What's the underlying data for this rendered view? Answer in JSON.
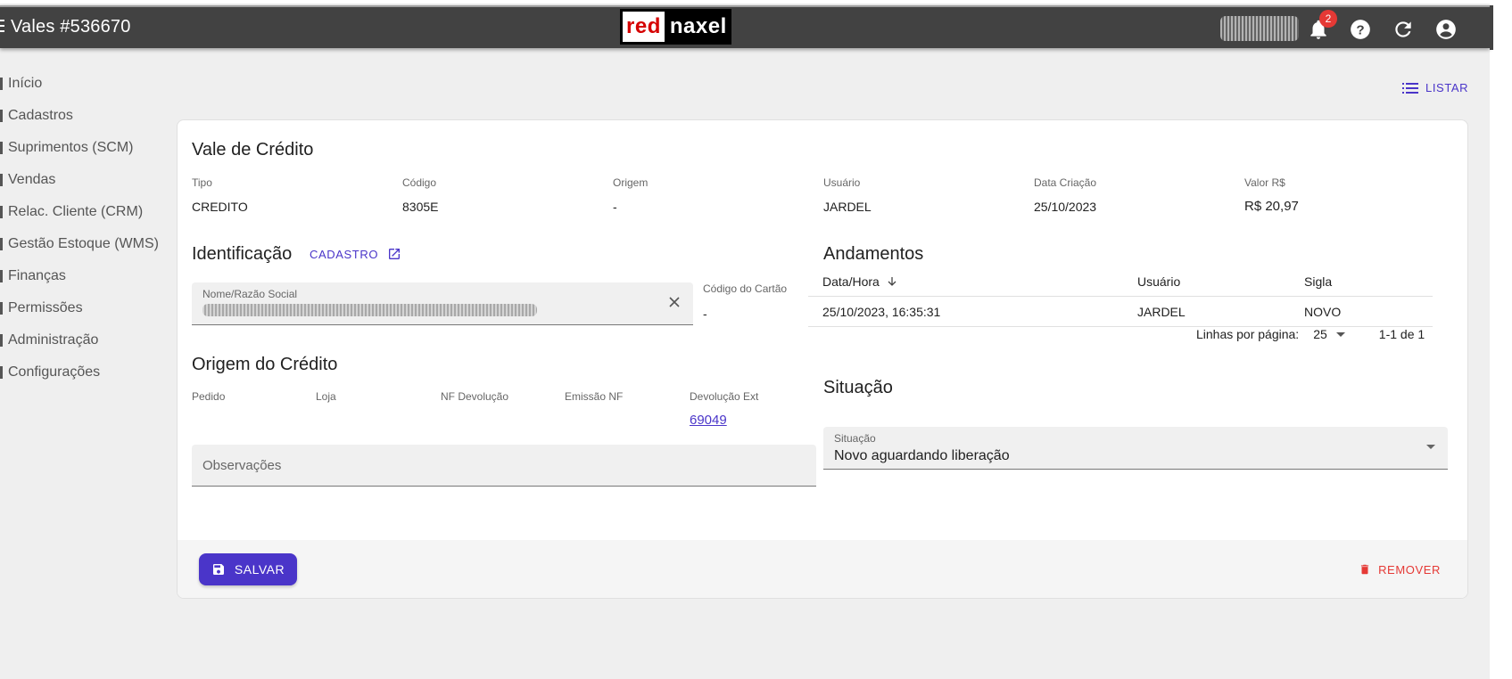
{
  "header": {
    "title": "Vales #536670",
    "logo_red": "red",
    "logo_naxel": "naxel",
    "notification_count": "2"
  },
  "sidebar": {
    "items": [
      {
        "label": "Início"
      },
      {
        "label": "Cadastros"
      },
      {
        "label": "Suprimentos (SCM)"
      },
      {
        "label": "Vendas"
      },
      {
        "label": "Relac. Cliente (CRM)"
      },
      {
        "label": "Gestão Estoque (WMS)"
      },
      {
        "label": "Finanças"
      },
      {
        "label": "Permissões"
      },
      {
        "label": "Administração"
      },
      {
        "label": "Configurações"
      }
    ]
  },
  "toolbar": {
    "listar_label": "LISTAR"
  },
  "vale": {
    "title": "Vale de Crédito",
    "fields": [
      {
        "label": "Tipo",
        "value": "CREDITO"
      },
      {
        "label": "Código",
        "value": "8305E"
      },
      {
        "label": "Origem",
        "value": "-"
      },
      {
        "label": "Usuário",
        "value": "JARDEL"
      },
      {
        "label": "Data Criação",
        "value": "25/10/2023"
      },
      {
        "label": "Valor R$",
        "value": "R$ 20,97"
      }
    ]
  },
  "identificacao": {
    "title": "Identificação",
    "cadastro_label": "CADASTRO",
    "nome_label": "Nome/Razão Social",
    "cartao_label": "Código do Cartão",
    "cartao_value": "-"
  },
  "origem_credito": {
    "title": "Origem do Crédito",
    "fields": [
      {
        "label": "Pedido",
        "value": ""
      },
      {
        "label": "Loja",
        "value": ""
      },
      {
        "label": "NF Devolução",
        "value": ""
      },
      {
        "label": "Emissão NF",
        "value": ""
      },
      {
        "label": "Devolução Ext",
        "value": "69049"
      }
    ],
    "observacoes_placeholder": "Observações"
  },
  "andamentos": {
    "title": "Andamentos",
    "columns": [
      "Data/Hora",
      "Usuário",
      "Sigla"
    ],
    "rows": [
      {
        "data_hora": "25/10/2023, 16:35:31",
        "usuario": "JARDEL",
        "sigla": "NOVO"
      }
    ],
    "pager_label": "Linhas por página:",
    "pager_value": "25",
    "pager_range": "1-1 de 1"
  },
  "situacao": {
    "title": "Situação",
    "field_label": "Situação",
    "field_value": "Novo aguardando liberação"
  },
  "actions": {
    "save_label": "SALVAR",
    "remove_label": "REMOVER"
  },
  "colors": {
    "primary": "#4a35c9",
    "topbar": "#424242",
    "danger": "#e53935"
  }
}
